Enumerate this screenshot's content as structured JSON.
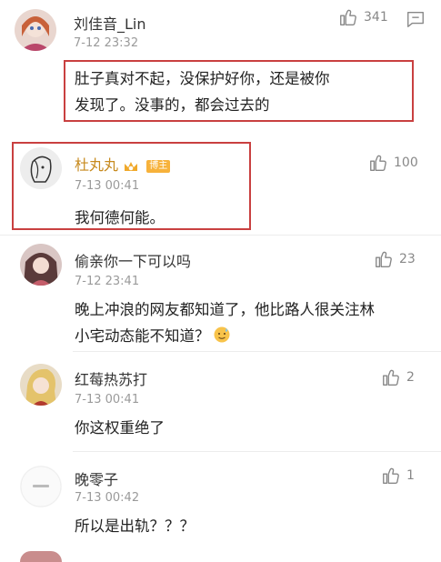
{
  "colors": {
    "highlight_border": "#c94040",
    "name_gold": "#c78a1e",
    "muted": "#9a9a9a",
    "badge": "#f7b23b"
  },
  "icons": {
    "like": "thumbs-up-icon",
    "reply": "comment-reply-icon",
    "crown": "crown-badge-icon"
  },
  "comments": [
    {
      "user": "刘佳音_Lin",
      "time": "7-12 23:32",
      "likes": "341",
      "line1": "肚子真对不起，没保护好你，还是被你",
      "line2": "发现了。没事的，都会过去的"
    },
    {
      "user": "杜丸丸",
      "badge": "博主",
      "time": "7-13 00:41",
      "likes": "100",
      "line1": "我何德何能。"
    },
    {
      "user": "偷亲你一下可以吗",
      "time": "7-12 23:41",
      "likes": "23",
      "line1": "晚上冲浪的网友都知道了，他比路人很关注林",
      "line2": "小宅动态能不知道？"
    },
    {
      "user": "红莓热苏打",
      "time": "7-13 00:41",
      "likes": "2",
      "line1": "你这权重绝了"
    },
    {
      "user": "晚零子",
      "time": "7-13 00:42",
      "likes": "1",
      "line1": "所以是出轨？？？"
    }
  ]
}
